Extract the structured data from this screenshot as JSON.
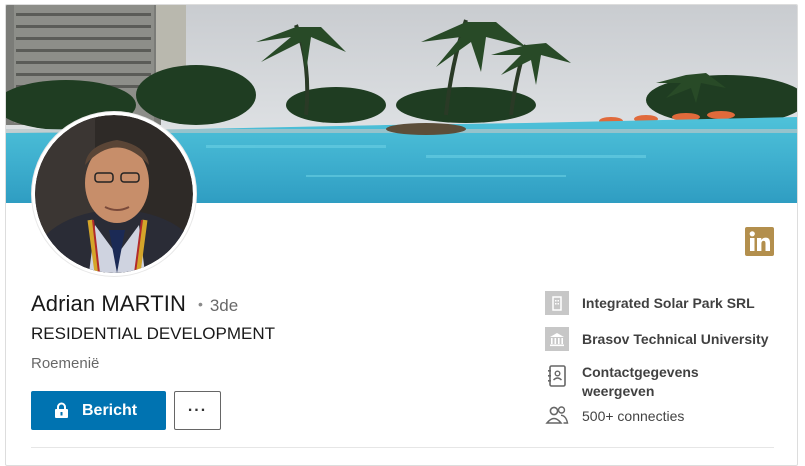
{
  "profile": {
    "name": "Adrian MARTIN",
    "connection_separator": "•",
    "connection_degree": "3de",
    "headline": "RESIDENTIAL DEVELOPMENT",
    "location": "Roemenië",
    "banner_description_icon": "pool-banner-image",
    "avatar_icon": "profile-photo"
  },
  "actions": {
    "message_label": "Bericht",
    "message_icon": "lock-icon",
    "more_label": "..."
  },
  "sidebar": {
    "items": [
      {
        "label": "Integrated Solar Park SRL",
        "icon": "company-icon"
      },
      {
        "label": "Brasov Technical University",
        "icon": "school-icon"
      },
      {
        "label": "Contactgegevens\nweergeven",
        "line1": "Contactgegevens",
        "line2": "weergeven",
        "icon": "contact-book-icon"
      },
      {
        "label": "500+ connecties",
        "icon": "people-icon"
      }
    ]
  },
  "colors": {
    "primary": "#0073b1",
    "linkedin_logo": "#b38f4d",
    "logo_box_gray": "#c7c7c7"
  }
}
